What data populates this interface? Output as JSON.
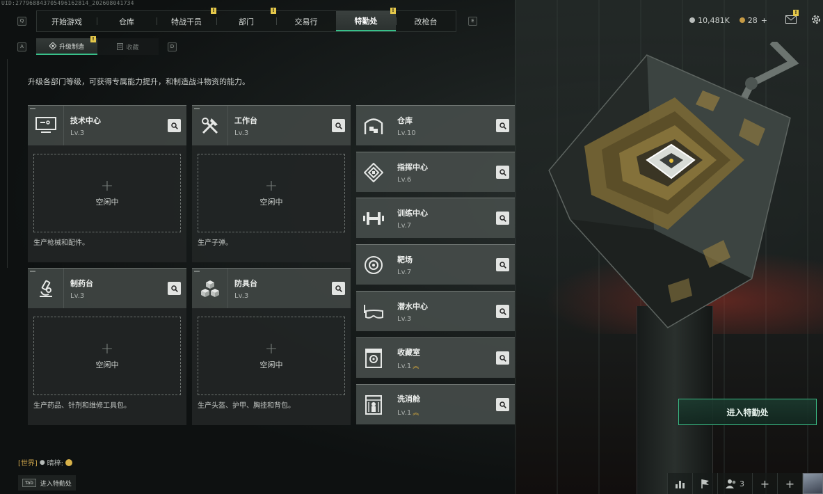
{
  "uid": "UID:277968843705496162814_202608041734",
  "nav": {
    "left_hint": "Q",
    "right_hint": "E",
    "tabs": [
      {
        "label": "开始游戏",
        "badge": "",
        "active": false
      },
      {
        "label": "仓库",
        "badge": "",
        "active": false
      },
      {
        "label": "特战干员",
        "badge": "!",
        "active": false
      },
      {
        "label": "部门",
        "badge": "!",
        "active": false
      },
      {
        "label": "交易行",
        "badge": "",
        "active": false
      },
      {
        "label": "特勤处",
        "badge": "!",
        "active": true
      },
      {
        "label": "改枪台",
        "badge": "",
        "active": false
      }
    ]
  },
  "currency": {
    "coins": "10,481K",
    "tickets": "28",
    "add": "+",
    "mail_badge": "!"
  },
  "subnav": {
    "left_hint": "A",
    "right_hint": "D",
    "upgrade_label": "升级制造",
    "upgrade_badge": "!",
    "collect_label": "收藏"
  },
  "description": "升级各部门等级，可获得专属能力提升，和制造战斗物资的能力。",
  "production": {
    "idle_label": "空闲中",
    "plus": "+",
    "stations": [
      {
        "name": "技术中心",
        "level": "Lv.3",
        "icon": "computer-icon",
        "desc": "生产枪械和配件。"
      },
      {
        "name": "工作台",
        "level": "Lv.3",
        "icon": "tools-icon",
        "desc": "生产子弹。"
      },
      {
        "name": "制药台",
        "level": "Lv.3",
        "icon": "microscope-icon",
        "desc": "生产药品、针剂和维修工具包。"
      },
      {
        "name": "防具台",
        "level": "Lv.3",
        "icon": "cubes-icon",
        "desc": "生产头盔、护甲、胸挂和背包。"
      }
    ]
  },
  "departments": [
    {
      "name": "仓库",
      "level": "Lv.10",
      "icon": "warehouse-icon",
      "upgradable": false
    },
    {
      "name": "指挥中心",
      "level": "Lv.6",
      "icon": "command-icon",
      "upgradable": false
    },
    {
      "name": "训练中心",
      "level": "Lv.7",
      "icon": "dumbbell-icon",
      "upgradable": false
    },
    {
      "name": "靶场",
      "level": "Lv.7",
      "icon": "target-icon",
      "upgradable": false
    },
    {
      "name": "潜水中心",
      "level": "Lv.3",
      "icon": "diving-mask-icon",
      "upgradable": false
    },
    {
      "name": "收藏室",
      "level": "Lv.1",
      "icon": "collection-icon",
      "upgradable": true
    },
    {
      "name": "洗消舱",
      "level": "Lv.1",
      "icon": "decon-icon",
      "upgradable": true
    }
  ],
  "enter_button": "进入特勤处",
  "chat": {
    "channel": "[世界]",
    "user": "晴梓:"
  },
  "tab_hint": {
    "key": "Tab",
    "label": "进入特勤处"
  },
  "bottom_tools": {
    "team_count": "3"
  },
  "colors": {
    "accent_green": "#38c08a",
    "badge_yellow": "#e5c84a",
    "upgrade_gold": "#e3b23c"
  }
}
